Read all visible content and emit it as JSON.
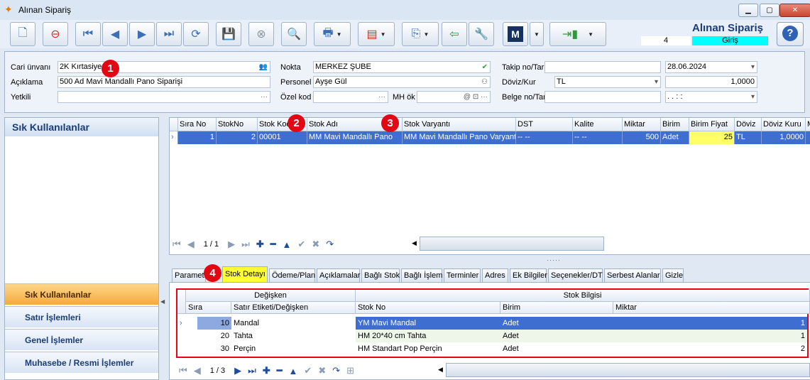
{
  "window": {
    "title": "Alınan Sipariş",
    "minimize": "▁",
    "maximize": "▢",
    "close": "✕"
  },
  "header": {
    "app_title": "Alınan Sipariş",
    "record_count": "4",
    "mode": "Giriş",
    "help": "?"
  },
  "toolbar": {
    "m_label": "M"
  },
  "form": {
    "cari_label": "Cari ünvanı",
    "cari_value": "2K Kırtasiye",
    "aciklama_label": "Açıklama",
    "aciklama_value": "500 Ad Mavi Mandallı Pano Siparişi",
    "yetkili_label": "Yetkili",
    "yetkili_value": "",
    "nokta_label": "Nokta",
    "nokta_value": "MERKEZ ŞUBE",
    "personel_label": "Personel",
    "personel_value": "Ayşe Gül",
    "ozelkod_label": "Özel kod",
    "ozelkod_value": "",
    "mhok_label": "MH ök",
    "mhok_value": "",
    "takip_label": "Takip no/Tarih",
    "takip_value": "",
    "takip_date": "28.06.2024",
    "doviz_label": "Döviz/Kur",
    "doviz_value": "TL",
    "kur_value": "1,0000",
    "belge_label": "Belge no/Tarih",
    "belge_value": "",
    "belge_date": ". .   : :"
  },
  "badges": {
    "b1": "1",
    "b2": "2",
    "b3": "3",
    "b4": "4"
  },
  "left_panel": {
    "title": "Sık Kullanılanlar",
    "items": [
      "Sık Kullanılanlar",
      "Satır İşlemleri",
      "Genel İşlemler",
      "Muhasebe / Resmi İşlemler"
    ]
  },
  "grid": {
    "columns": [
      "Sıra No",
      "StokNo",
      "Stok Kodu",
      "Stok Adı",
      "Stok Varyantı",
      "DST",
      "Kalite",
      "Miktar",
      "Birim",
      "Birim Fiyat",
      "Döviz",
      "Döviz Kuru",
      "M"
    ],
    "row": {
      "sira": "1",
      "stokno": "2",
      "stokkodu": "00001",
      "stokadi": "MM Mavi Mandallı Pano",
      "varyant": "MM Mavi Mandallı Pano Varyantı",
      "dst": "-- --",
      "kalite": "-- --",
      "miktar": "500",
      "birim": "Adet",
      "fiyat": "25",
      "doviz": "TL",
      "kur": "1,0000"
    },
    "page": "1 / 1"
  },
  "tabs": [
    "Parametre",
    "Stok Detayı",
    "Ödeme/Plan",
    "Açıklamalar",
    "Bağlı Stok",
    "Bağlı İşlem",
    "Terminler",
    "Adres",
    "Ek Bilgiler",
    "Seçenekler/DT",
    "Serbest Alanlar",
    "Gizle"
  ],
  "detail": {
    "group_left": "Değişken",
    "group_right": "Stok Bilgisi",
    "columns": [
      "Sıra",
      "Satır Etiketi/Değişken",
      "Stok No",
      "Birim",
      "Miktar"
    ],
    "rows": [
      {
        "sira": "10",
        "etiket": "Mandal",
        "stok": "YM Mavi Mandal",
        "birim": "Adet",
        "miktar": "1"
      },
      {
        "sira": "20",
        "etiket": "Tahta",
        "stok": "HM 20*40 cm Tahta",
        "birim": "Adet",
        "miktar": "1"
      },
      {
        "sira": "30",
        "etiket": "Perçin",
        "stok": "HM Standart Pop Perçin",
        "birim": "Adet",
        "miktar": "2"
      }
    ],
    "page": "1 / 3"
  }
}
